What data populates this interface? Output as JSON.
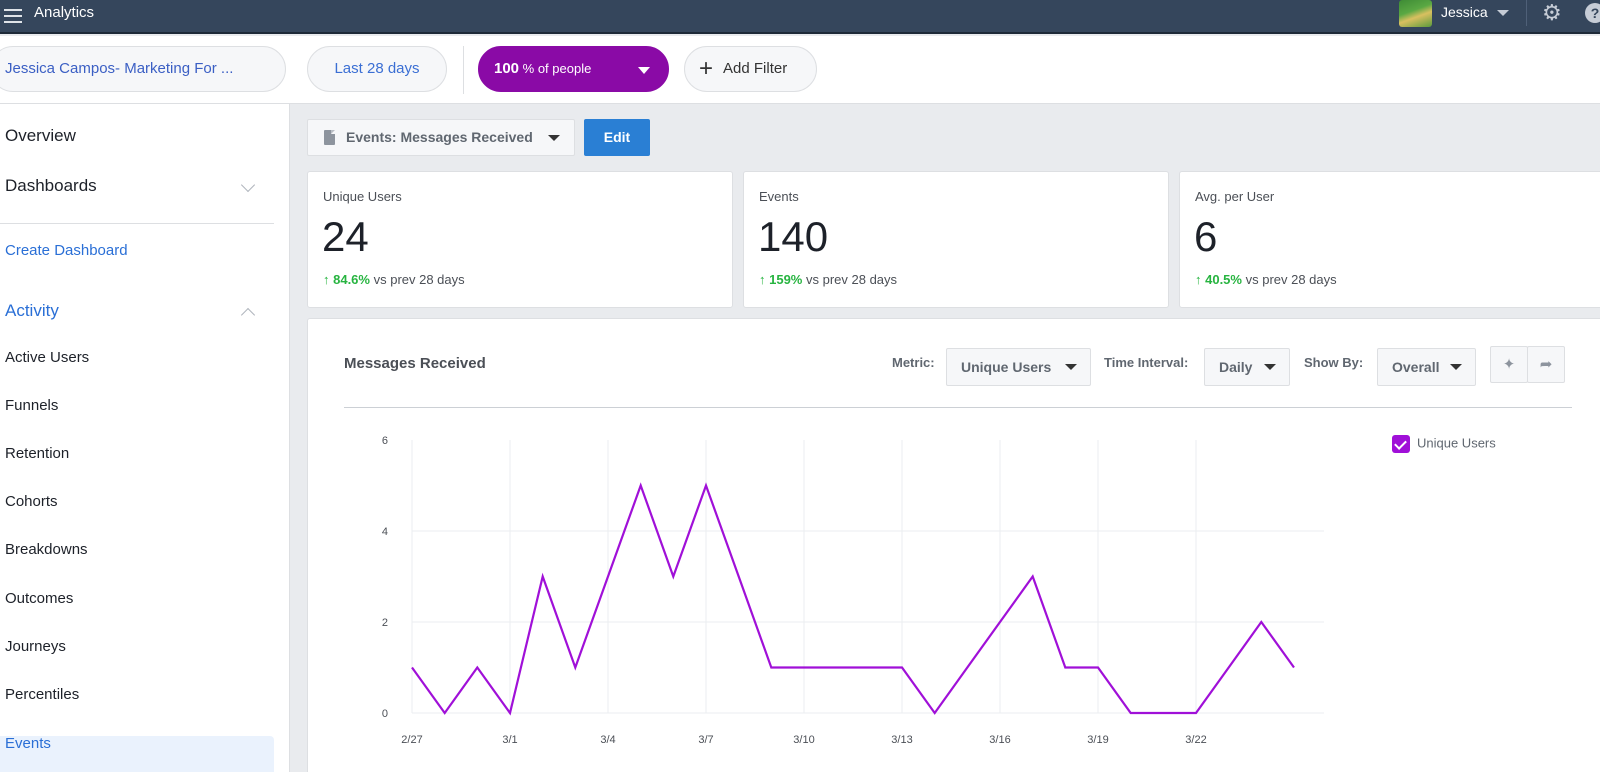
{
  "topbar": {
    "title": "Analytics",
    "user_name": "Jessica",
    "gear_icon": "gear-icon",
    "help_icon": "help-icon",
    "help_glyph": "?"
  },
  "filters": {
    "app_name": "Jessica Campos- Marketing For ...",
    "date_range": "Last 28 days",
    "people_value": "100",
    "people_suffix": " % of people",
    "add_filter": "Add Filter",
    "add_glyph": "+"
  },
  "sidebar": {
    "overview": "Overview",
    "dashboards": "Dashboards",
    "create_dashboard": "Create Dashboard",
    "activity": "Activity",
    "items": [
      {
        "label": "Active Users"
      },
      {
        "label": "Funnels"
      },
      {
        "label": "Retention"
      },
      {
        "label": "Cohorts"
      },
      {
        "label": "Breakdowns"
      },
      {
        "label": "Outcomes"
      },
      {
        "label": "Journeys"
      },
      {
        "label": "Percentiles"
      },
      {
        "label": "Events",
        "active": true
      }
    ]
  },
  "main": {
    "event_selector": "Events: Messages Received",
    "edit_label": "Edit",
    "cards": [
      {
        "label": "Unique Users",
        "value": "24",
        "delta": "↑ 84.6%",
        "delta_suffix": " vs prev 28 days"
      },
      {
        "label": "Events",
        "value": "140",
        "delta": "↑ 159%",
        "delta_suffix": " vs prev 28 days"
      },
      {
        "label": "Avg. per User",
        "value": "6",
        "delta": "↑ 40.5%",
        "delta_suffix": " vs prev 28 days"
      }
    ],
    "panel": {
      "title": "Messages Received",
      "metric_label": "Metric:",
      "metric_value": "Unique Users",
      "interval_label": "Time Interval:",
      "interval_value": "Daily",
      "showby_label": "Show By:",
      "showby_value": "Overall",
      "pin_glyph": "📌",
      "share_glyph": "➦"
    }
  },
  "colors": {
    "accent_purple": "#8a0aa6",
    "series_color": "#a010d8",
    "positive_green": "#27b440",
    "link_blue": "#2a6fd6",
    "topbar_bg": "#35465c",
    "edit_blue": "#2a7fd4"
  },
  "chart_data": {
    "type": "line",
    "title": "Messages Received",
    "xlabel": "",
    "ylabel": "",
    "x": [
      "2/27",
      "2/28",
      "2/29",
      "3/1",
      "3/2",
      "3/3",
      "3/4",
      "3/5",
      "3/6",
      "3/7",
      "3/8",
      "3/9",
      "3/10",
      "3/11",
      "3/12",
      "3/13",
      "3/14",
      "3/15",
      "3/16",
      "3/17",
      "3/18",
      "3/19",
      "3/20",
      "3/21",
      "3/22",
      "3/23",
      "3/24",
      "3/25"
    ],
    "x_tick_labels": [
      "2/27",
      "3/1",
      "3/4",
      "3/7",
      "3/10",
      "3/13",
      "3/16",
      "3/19",
      "3/22"
    ],
    "y_ticks": [
      0,
      2,
      4,
      6
    ],
    "ylim": [
      0,
      6
    ],
    "grid": true,
    "legend_position": "top-right",
    "series": [
      {
        "name": "Unique Users",
        "values": [
          1,
          0,
          1,
          0,
          3,
          1,
          3,
          5,
          3,
          5,
          3,
          1,
          1,
          1,
          1,
          1,
          0,
          1,
          2,
          3,
          1,
          1,
          0,
          0,
          0,
          1,
          2,
          1
        ]
      }
    ]
  }
}
